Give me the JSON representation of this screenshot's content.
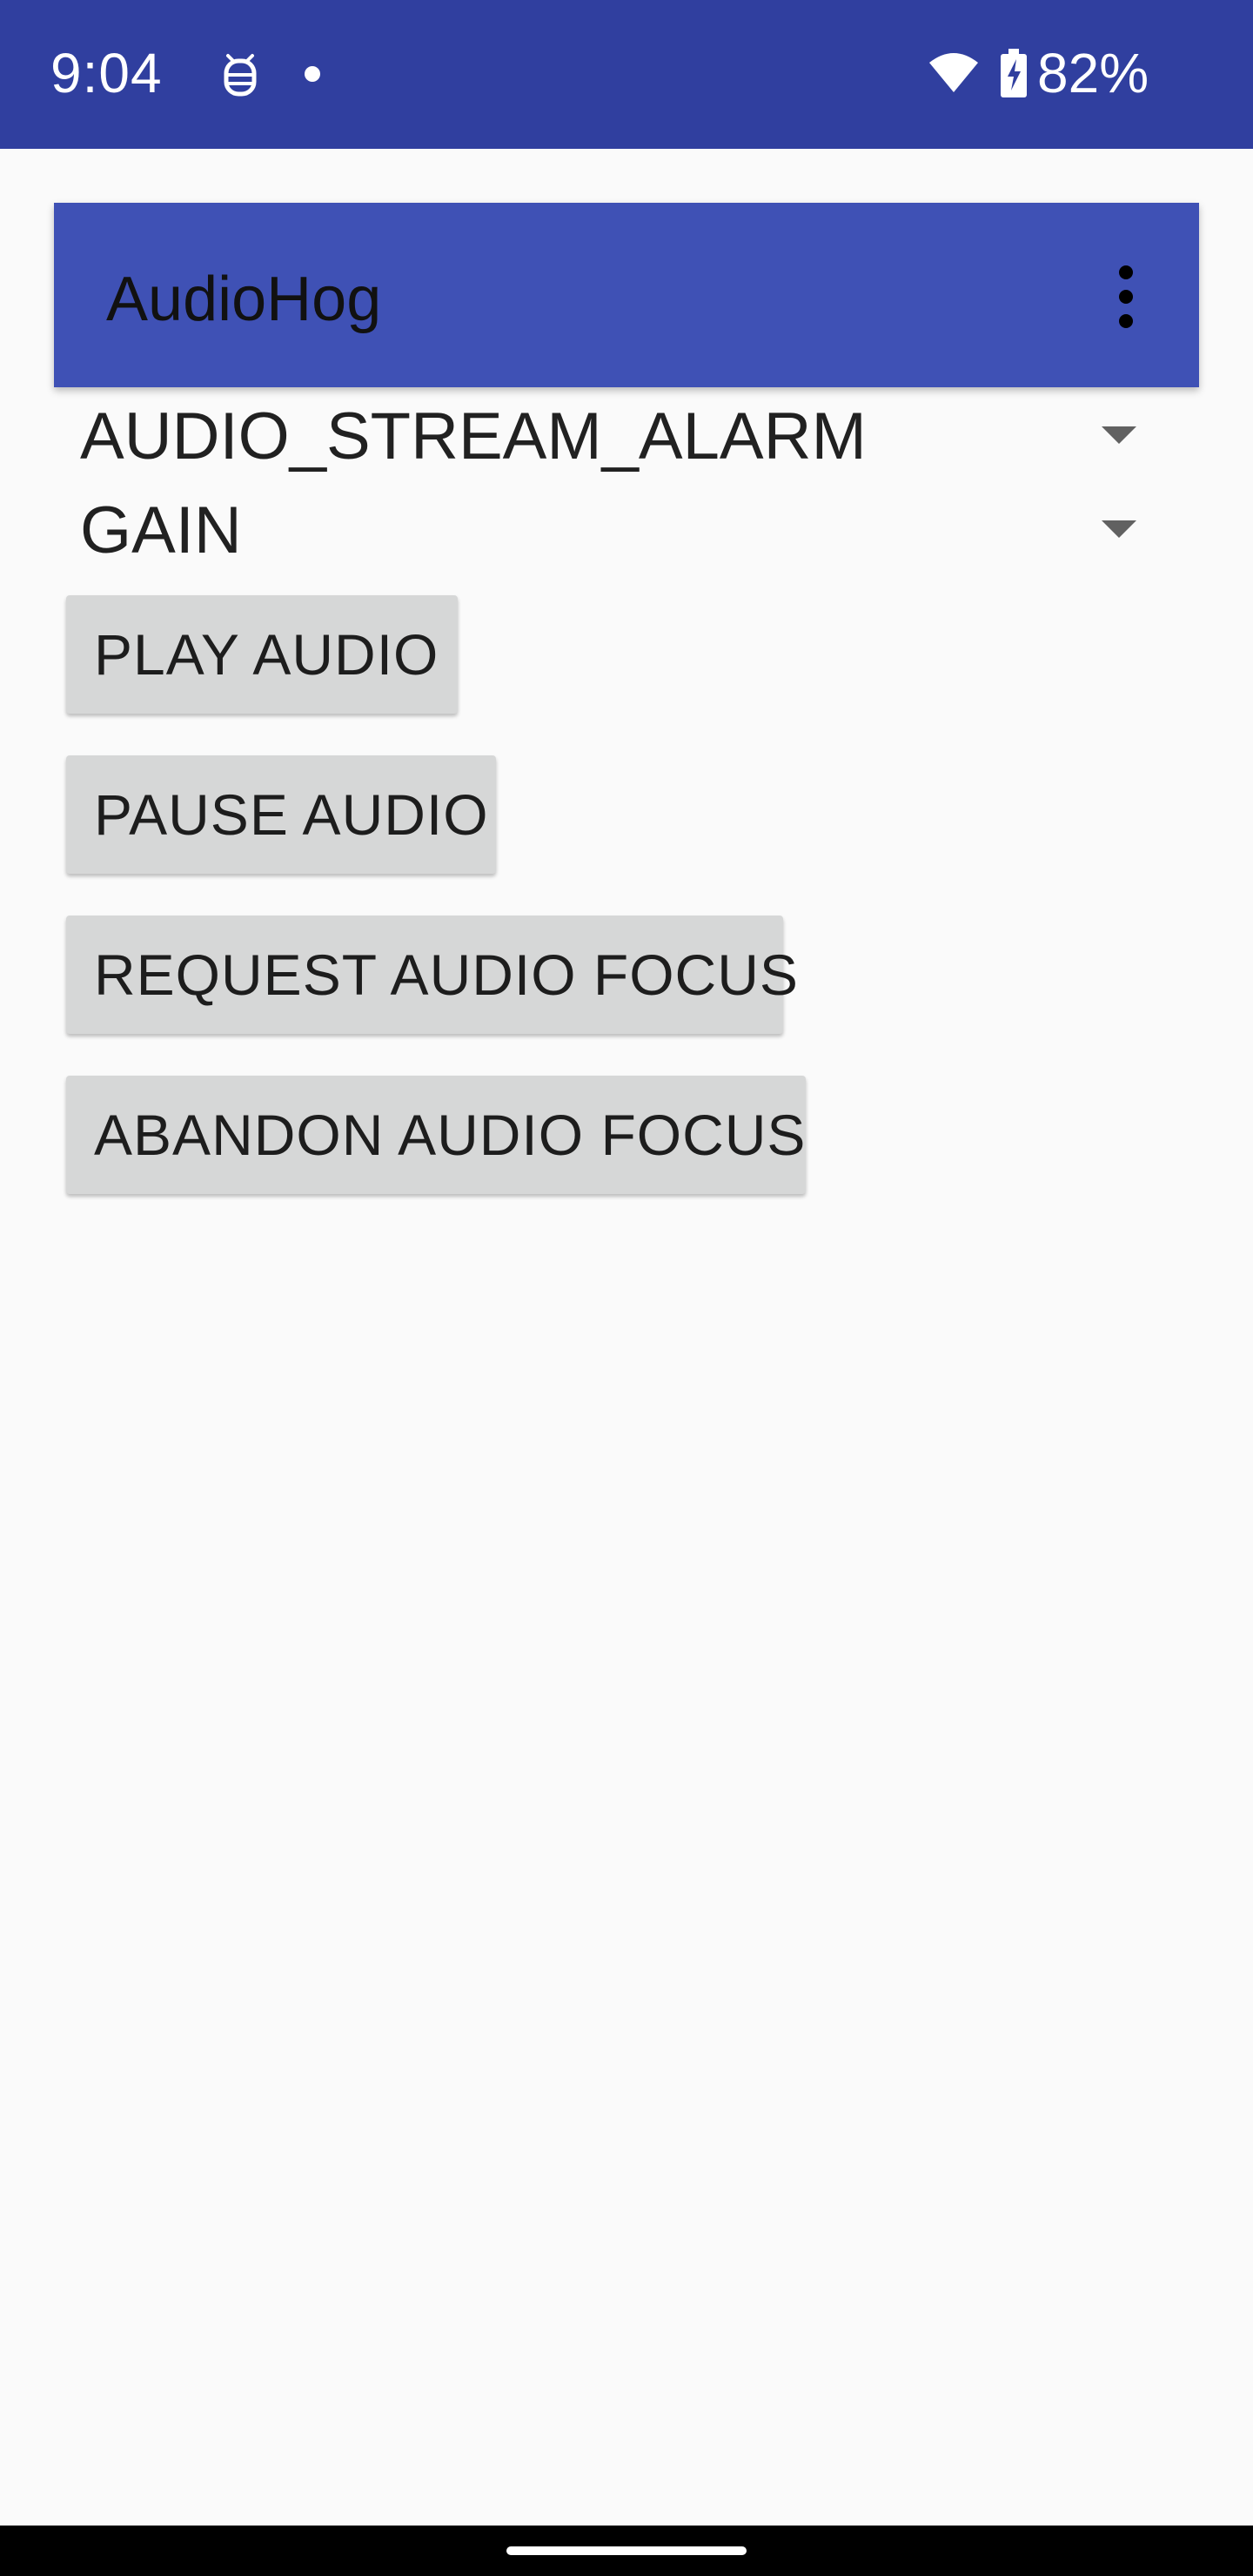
{
  "status_bar": {
    "time": "9:04",
    "battery_percent": "82%",
    "icons": [
      "android-debug-icon",
      "notification-dot-icon",
      "wifi-icon",
      "battery-charging-icon"
    ],
    "background_color": "#303f9f"
  },
  "app_bar": {
    "title": "AudioHog",
    "menu_icon": "overflow-menu-icon",
    "background_color": "#3f51b5"
  },
  "spinners": {
    "stream": {
      "value": "AUDIO_STREAM_ALARM"
    },
    "focus_type": {
      "value": "GAIN"
    }
  },
  "buttons": {
    "play": "PLAY AUDIO",
    "pause": "PAUSE AUDIO",
    "request_focus": "REQUEST AUDIO FOCUS",
    "abandon_focus": "ABANDON AUDIO FOCUS"
  },
  "colors": {
    "button_background": "#d6d7d7",
    "page_background": "#fafafa"
  }
}
